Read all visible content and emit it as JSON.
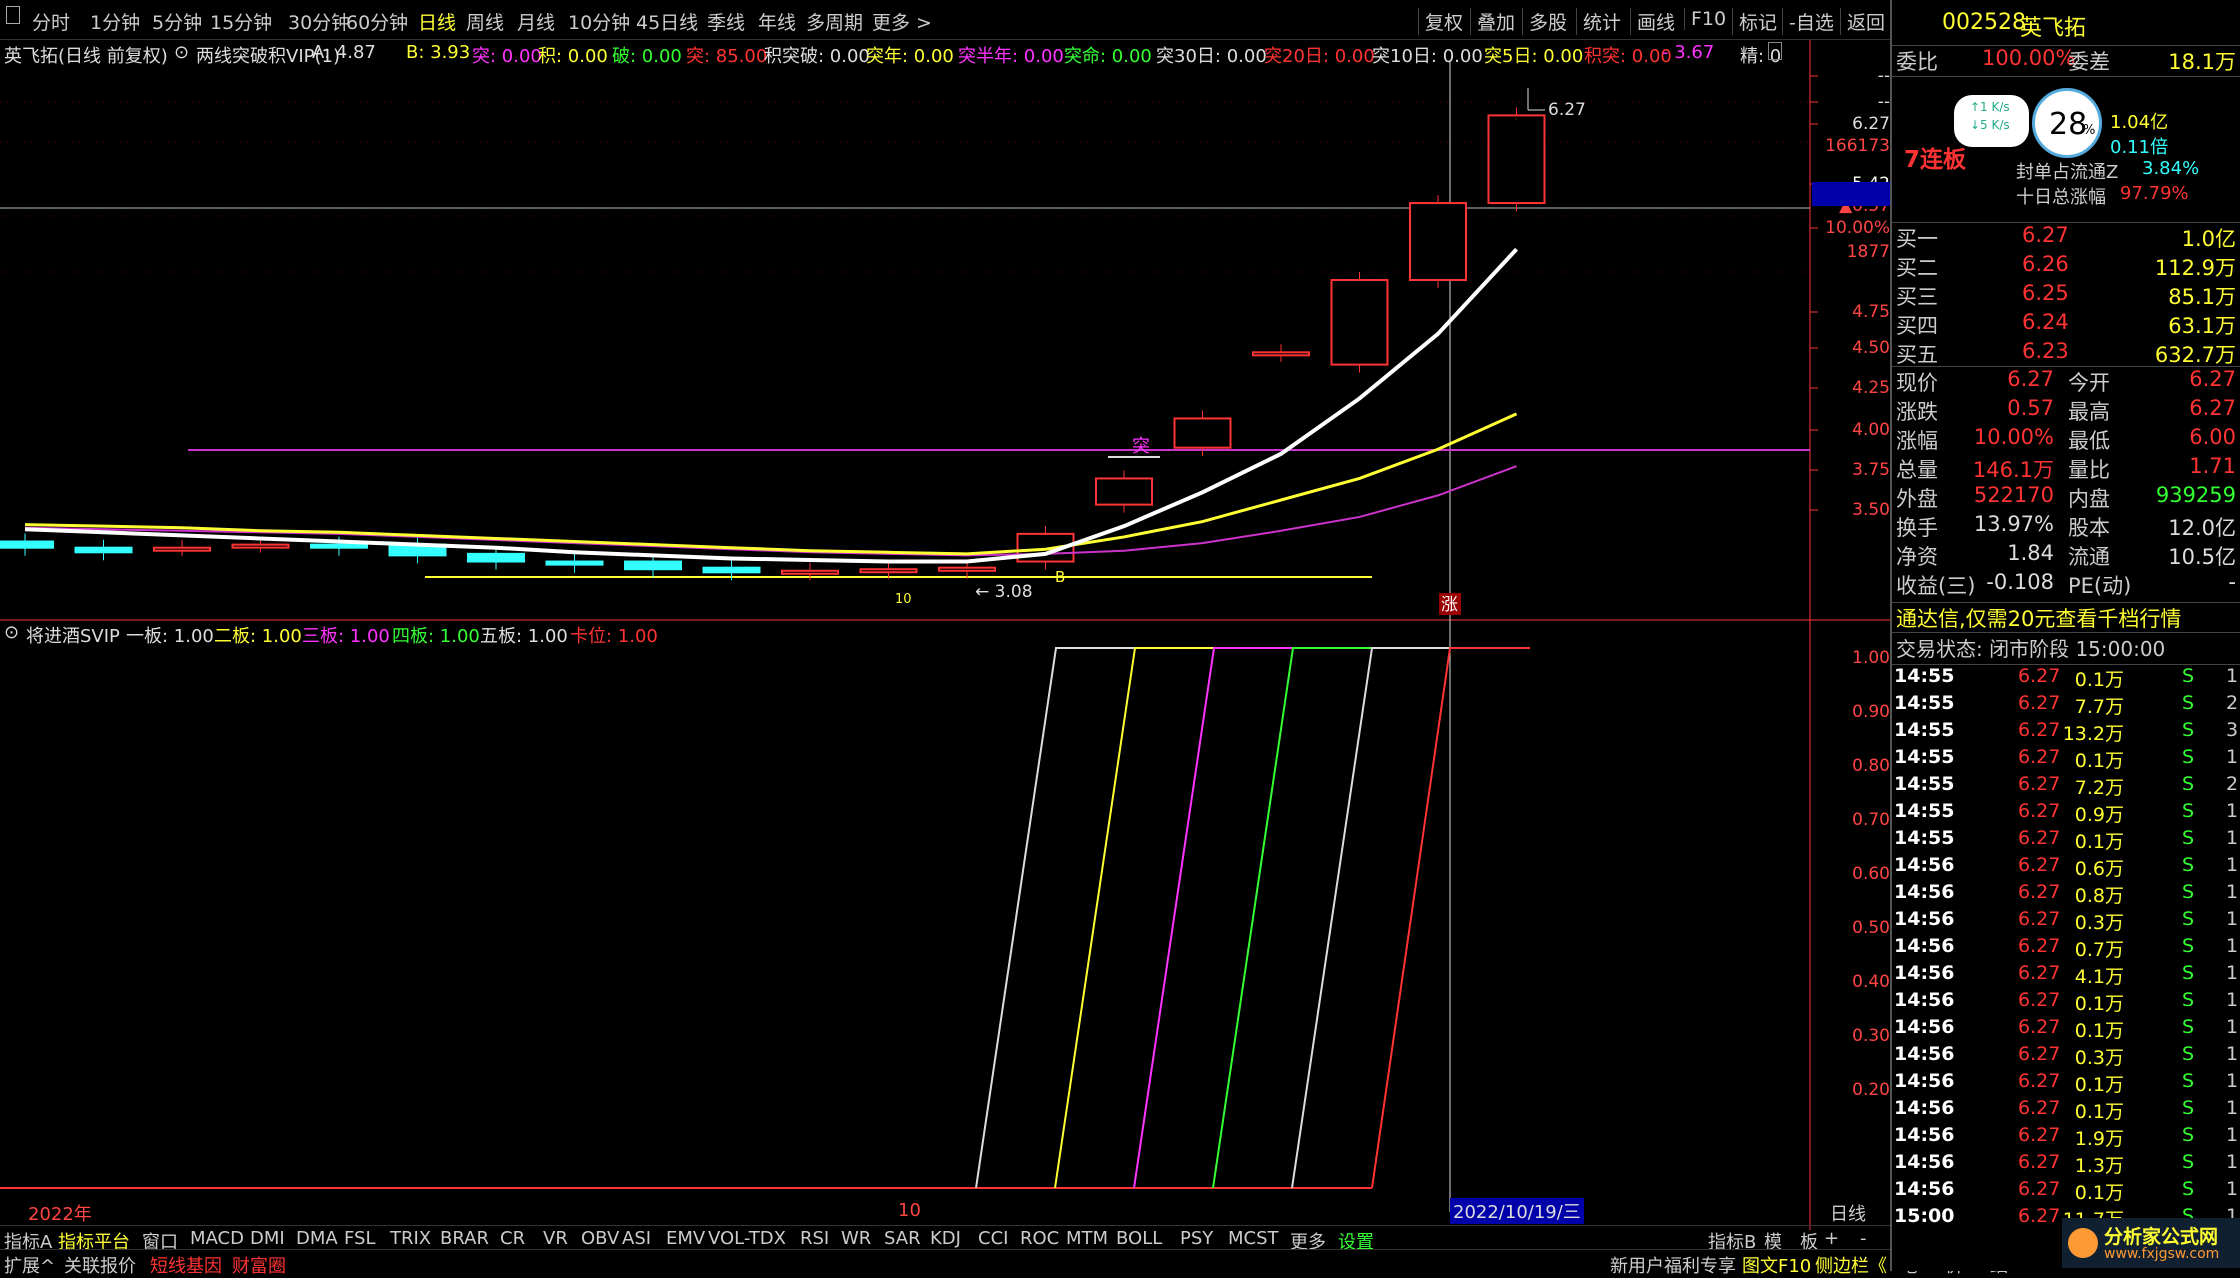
{
  "toolbar": {
    "periods": [
      "分时",
      "1分钟",
      "5分钟",
      "15分钟",
      "30分钟",
      "60分钟",
      "日线",
      "周线",
      "月线",
      "10分钟",
      "45日线",
      "季线",
      "年线",
      "多周期",
      "更多"
    ],
    "active": "日线",
    "right": [
      "复权",
      "叠加",
      "多股",
      "统计",
      "画线",
      "F10",
      "标记",
      "-自选",
      "返回"
    ]
  },
  "main": {
    "title": "英飞拓(日线 前复权)",
    "indicator": "两线突破积VIP(1)",
    "params": [
      {
        "t": "A: 4.87",
        "c": "wh"
      },
      {
        "t": "B: 3.93",
        "c": "yl"
      },
      {
        "t": "突: 0.00",
        "c": "mg"
      },
      {
        "t": "积: 0.00",
        "c": "yl"
      },
      {
        "t": "破: 0.00",
        "c": "gr"
      },
      {
        "t": "突: 85.00",
        "c": "rd"
      },
      {
        "t": "积突破: 0.00",
        "c": "wh"
      },
      {
        "t": "突年: 0.00",
        "c": "yl"
      },
      {
        "t": "突半年: 0.00",
        "c": "mg"
      },
      {
        "t": "突命: 0.00",
        "c": "gr"
      },
      {
        "t": "突30日: 0.00",
        "c": "wh"
      },
      {
        "t": "突20日: 0.00",
        "c": "rd"
      },
      {
        "t": "突10日: 0.00",
        "c": "wh"
      },
      {
        "t": "突5日: 0.00",
        "c": "yl"
      },
      {
        "t": "积突: 0.00",
        "c": "rd"
      },
      {
        "t": "- 3.67",
        "c": "mg"
      },
      {
        "t": "精: 0",
        "c": "wh"
      }
    ],
    "yaxis": [
      "--",
      "--",
      "6.27",
      "166173",
      "5.42",
      "▲0.57",
      "10.00%",
      "1877",
      "4.75",
      "4.50",
      "4.25",
      "4.00",
      "3.75",
      "3.50"
    ],
    "labels": {
      "high": "6.27",
      "low": "3.08",
      "tu": "突",
      "zhang": "涨",
      "b": "B",
      "ten": "10"
    }
  },
  "sub": {
    "title": "将进酒SVIP",
    "params": [
      {
        "t": "一板: 1.00",
        "c": "wh"
      },
      {
        "t": "二板: 1.00",
        "c": "yl"
      },
      {
        "t": "三板: 1.00",
        "c": "mg"
      },
      {
        "t": "四板: 1.00",
        "c": "gr"
      },
      {
        "t": "五板: 1.00",
        "c": "wh"
      },
      {
        "t": "卡位: 1.00",
        "c": "rd"
      }
    ],
    "yaxis": [
      "1.00",
      "0.90",
      "0.80",
      "0.70",
      "0.60",
      "0.50",
      "0.40",
      "0.30",
      "0.20"
    ],
    "x_labels": [
      "2022年",
      "10"
    ],
    "date": "2022/10/19/三",
    "period": "日线"
  },
  "chart_data": {
    "type": "candlestick",
    "days": [
      {
        "o": 3.5,
        "c": 3.46
      },
      {
        "o": 3.46,
        "c": 3.43
      },
      {
        "o": 3.46,
        "c": 3.46
      },
      {
        "o": 3.48,
        "c": 3.48
      },
      {
        "o": 3.48,
        "c": 3.46
      },
      {
        "o": 3.48,
        "c": 3.41
      },
      {
        "o": 3.42,
        "c": 3.37
      },
      {
        "o": 3.37,
        "c": 3.35
      },
      {
        "o": 3.37,
        "c": 3.32
      },
      {
        "o": 3.33,
        "c": 3.3
      },
      {
        "o": 3.3,
        "c": 3.31
      },
      {
        "o": 3.31,
        "c": 3.32
      },
      {
        "o": 3.31,
        "c": 3.33
      },
      {
        "o": 3.37,
        "c": 3.55
      },
      {
        "o": 3.74,
        "c": 3.91
      },
      {
        "o": 4.11,
        "c": 4.3
      },
      {
        "o": 4.72,
        "c": 4.73
      },
      {
        "o": 4.65,
        "c": 5.2
      },
      {
        "o": 5.2,
        "c": 5.7
      },
      {
        "o": 5.7,
        "c": 6.27
      }
    ],
    "lines": {
      "white": [
        3.58,
        3.56,
        3.54,
        3.52,
        3.5,
        3.48,
        3.46,
        3.43,
        3.41,
        3.39,
        3.38,
        3.37,
        3.37,
        3.42,
        3.6,
        3.82,
        4.07,
        4.43,
        4.85,
        5.4
      ],
      "yellow": [
        3.61,
        3.6,
        3.59,
        3.57,
        3.56,
        3.54,
        3.52,
        3.5,
        3.48,
        3.46,
        3.44,
        3.43,
        3.42,
        3.45,
        3.53,
        3.63,
        3.77,
        3.91,
        4.1,
        4.33
      ],
      "magenta": [
        3.59,
        3.58,
        3.57,
        3.56,
        3.55,
        3.53,
        3.51,
        3.49,
        3.47,
        3.45,
        3.43,
        3.42,
        3.41,
        3.42,
        3.44,
        3.49,
        3.57,
        3.66,
        3.8,
        3.99
      ]
    },
    "ylim": [
      3.25,
      6.5
    ]
  },
  "right": {
    "code": "002528",
    "name": "英飞拓",
    "weibi": "委比",
    "weibi_val": "100.00%",
    "weicha": "委差",
    "weicha_val": "18.1万",
    "board": "7连板",
    "speed1": "↑1 K/s",
    "speed2": "↓5 K/s",
    "pct": "28",
    "fd1": "1.04亿",
    "fd2": "0.11倍",
    "fengdan": "封单占流通Z",
    "fengdan_val": "3.84%",
    "shiri": "十日总涨幅",
    "shiri_val": "97.79%",
    "buys": [
      [
        "买一",
        "6.27",
        "1.0亿"
      ],
      [
        "买二",
        "6.26",
        "112.9万"
      ],
      [
        "买三",
        "6.25",
        "85.1万"
      ],
      [
        "买四",
        "6.24",
        "63.1万"
      ],
      [
        "买五",
        "6.23",
        "632.7万"
      ]
    ],
    "stats": [
      [
        "现价",
        "6.27",
        "今开",
        "6.27"
      ],
      [
        "涨跌",
        "0.57",
        "最高",
        "6.27"
      ],
      [
        "涨幅",
        "10.00%",
        "最低",
        "6.00"
      ],
      [
        "总量",
        "146.1万",
        "量比",
        "1.71"
      ],
      [
        "外盘",
        "522170",
        "内盘",
        "939259"
      ],
      [
        "换手",
        "13.97%",
        "股本",
        "12.0亿"
      ],
      [
        "净资",
        "1.84",
        "流通",
        "10.5亿"
      ],
      [
        "收益(三)",
        "-0.108",
        "PE(动)",
        "-"
      ]
    ],
    "ad": "通达信,仅需20元查看千档行情",
    "status": "交易状态: 闭市阶段 15:00:00",
    "ticks": [
      [
        "14:55",
        "6.27",
        "0.1万",
        "S",
        "1"
      ],
      [
        "14:55",
        "6.27",
        "7.7万",
        "S",
        "2"
      ],
      [
        "14:55",
        "6.27",
        "13.2万",
        "S",
        "3"
      ],
      [
        "14:55",
        "6.27",
        "0.1万",
        "S",
        "1"
      ],
      [
        "14:55",
        "6.27",
        "7.2万",
        "S",
        "2"
      ],
      [
        "14:55",
        "6.27",
        "0.9万",
        "S",
        "1"
      ],
      [
        "14:55",
        "6.27",
        "0.1万",
        "S",
        "1"
      ],
      [
        "14:56",
        "6.27",
        "0.6万",
        "S",
        "1"
      ],
      [
        "14:56",
        "6.27",
        "0.8万",
        "S",
        "1"
      ],
      [
        "14:56",
        "6.27",
        "0.3万",
        "S",
        "1"
      ],
      [
        "14:56",
        "6.27",
        "0.7万",
        "S",
        "1"
      ],
      [
        "14:56",
        "6.27",
        "4.1万",
        "S",
        "1"
      ],
      [
        "14:56",
        "6.27",
        "0.1万",
        "S",
        "1"
      ],
      [
        "14:56",
        "6.27",
        "0.1万",
        "S",
        "1"
      ],
      [
        "14:56",
        "6.27",
        "0.3万",
        "S",
        "1"
      ],
      [
        "14:56",
        "6.27",
        "0.1万",
        "S",
        "1"
      ],
      [
        "14:56",
        "6.27",
        "0.1万",
        "S",
        "1"
      ],
      [
        "14:56",
        "6.27",
        "1.9万",
        "S",
        "1"
      ],
      [
        "14:56",
        "6.27",
        "1.3万",
        "S",
        "1"
      ],
      [
        "14:56",
        "6.27",
        "0.1万",
        "S",
        "1"
      ],
      [
        "15:00",
        "6.27",
        "11.7万",
        "S",
        "1"
      ]
    ]
  },
  "bottom": {
    "tabs": [
      "指标A",
      "指标平台",
      "窗口",
      "MACD",
      "DMI",
      "DMA",
      "FSL",
      "TRIX",
      "BRAR",
      "CR",
      "VR",
      "OBV",
      "ASI",
      "EMV",
      "VOL-TDX",
      "RSI",
      "WR",
      "SAR",
      "KDJ",
      "CCI",
      "ROC",
      "MTM",
      "BOLL",
      "PSY",
      "MCST",
      "更多",
      "设置"
    ],
    "right": [
      "指标B",
      "模",
      "板",
      "+",
      "-"
    ],
    "row2": [
      "扩展^",
      "关联报价",
      "短线基因",
      "财富圈"
    ],
    "footer": "新用户福利专享",
    "f10": "图文F10",
    "side": "侧边栏《",
    "ft": [
      "笔",
      "价",
      "细"
    ],
    "watermark": "分析家公式网",
    "wurl": "www.fxjgsw.com"
  }
}
